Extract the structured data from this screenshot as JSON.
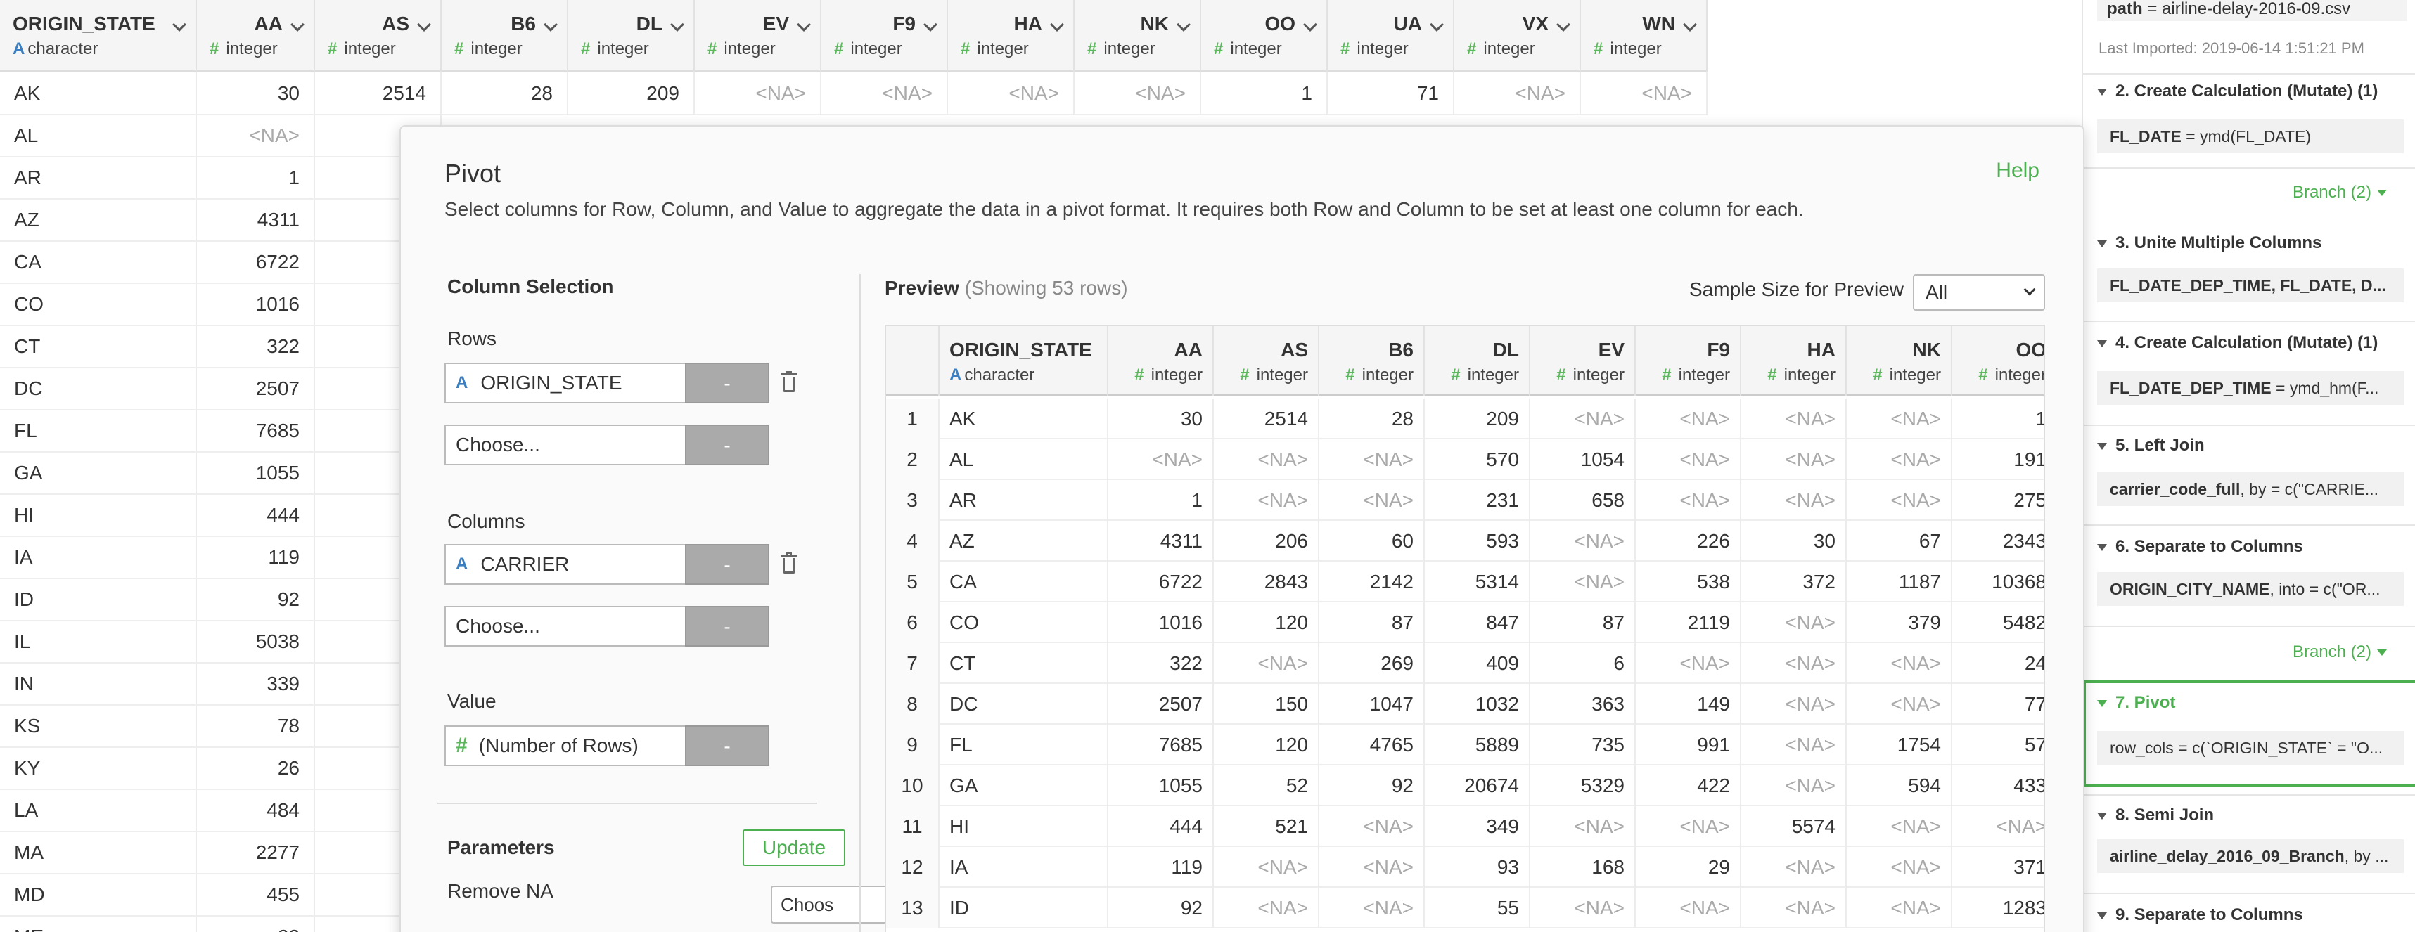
{
  "background_table": {
    "columns": [
      {
        "name": "ORIGIN_STATE",
        "type": "character",
        "icon": "a-char-icon"
      },
      {
        "name": "AA",
        "type": "integer",
        "icon": "hash-icon"
      },
      {
        "name": "AS",
        "type": "integer",
        "icon": "hash-icon"
      },
      {
        "name": "B6",
        "type": "integer",
        "icon": "hash-icon"
      },
      {
        "name": "DL",
        "type": "integer",
        "icon": "hash-icon"
      },
      {
        "name": "EV",
        "type": "integer",
        "icon": "hash-icon"
      },
      {
        "name": "F9",
        "type": "integer",
        "icon": "hash-icon"
      },
      {
        "name": "HA",
        "type": "integer",
        "icon": "hash-icon"
      },
      {
        "name": "NK",
        "type": "integer",
        "icon": "hash-icon"
      },
      {
        "name": "OO",
        "type": "integer",
        "icon": "hash-icon"
      },
      {
        "name": "UA",
        "type": "integer",
        "icon": "hash-icon"
      },
      {
        "name": "VX",
        "type": "integer",
        "icon": "hash-icon"
      },
      {
        "name": "WN",
        "type": "integer",
        "icon": "hash-icon"
      }
    ],
    "first_row": [
      "AK",
      "30",
      "2514",
      "28",
      "209",
      "<NA>",
      "<NA>",
      "<NA>",
      "<NA>",
      "1",
      "71",
      "<NA>",
      "<NA>"
    ],
    "rows": [
      [
        "AL",
        "<NA>",
        "<N"
      ],
      [
        "AR",
        "1",
        "<N"
      ],
      [
        "AZ",
        "4311",
        ""
      ],
      [
        "CA",
        "6722",
        "2"
      ],
      [
        "CO",
        "1016",
        ""
      ],
      [
        "CT",
        "322",
        "<N"
      ],
      [
        "DC",
        "2507",
        ""
      ],
      [
        "FL",
        "7685",
        ""
      ],
      [
        "GA",
        "1055",
        ""
      ],
      [
        "HI",
        "444",
        ""
      ],
      [
        "IA",
        "119",
        "<N"
      ],
      [
        "ID",
        "92",
        "<N"
      ],
      [
        "IL",
        "5038",
        ""
      ],
      [
        "IN",
        "339",
        "<N"
      ],
      [
        "KS",
        "78",
        "<N"
      ],
      [
        "KY",
        "26",
        "<N"
      ],
      [
        "LA",
        "484",
        ""
      ],
      [
        "MA",
        "2277",
        ""
      ],
      [
        "MD",
        "455",
        ""
      ],
      [
        "ME",
        "22",
        ""
      ]
    ]
  },
  "sidebar": {
    "path_label": "path",
    "path_value": " = airline-delay-2016-09.csv",
    "last_imported": "Last Imported: 2019-06-14 1:51:21 PM",
    "steps": [
      {
        "title": "2. Create Calculation (Mutate) (1)",
        "body_bold": "FL_DATE",
        "body_rest": " = ymd(FL_DATE)"
      },
      {
        "title": "3. Unite Multiple Columns",
        "body_bold": "FL_DATE_DEP_TIME, FL_DATE, D...",
        "body_rest": ""
      },
      {
        "title": "4. Create Calculation (Mutate) (1)",
        "body_bold": "FL_DATE_DEP_TIME",
        "body_rest": " = ymd_hm(F..."
      },
      {
        "title": "5. Left Join",
        "body_bold": "carrier_code_full",
        "body_rest": ", by = c(\"CARRIE..."
      },
      {
        "title": "6. Separate to Columns",
        "body_bold": "ORIGIN_CITY_NAME",
        "body_rest": ", into = c(\"OR..."
      },
      {
        "title": "7. Pivot",
        "body_bold": "",
        "body_rest": "row_cols = c(`ORIGIN_STATE` = \"O..."
      },
      {
        "title": "8. Semi Join",
        "body_bold": "airline_delay_2016_09_Branch",
        "body_rest": ", by ..."
      },
      {
        "title": "9. Separate to Columns",
        "body_bold": "",
        "body_rest": ""
      }
    ],
    "branch_label": "Branch (2)",
    "colors": {
      "accent": "#4caf50"
    }
  },
  "dialog": {
    "title": "Pivot",
    "help": "Help",
    "description": "Select columns for Row, Column, and Value to aggregate the data in a pivot format. It requires both Row and Column to be set at least one column for each.",
    "column_selection": "Column Selection",
    "rows_label": "Rows",
    "rows_value": "ORIGIN_STATE",
    "choose_placeholder": "Choose...",
    "columns_label": "Columns",
    "columns_value": "CARRIER",
    "value_label": "Value",
    "value_value": "(Number of Rows)",
    "minus": "-",
    "parameters": "Parameters",
    "update": "Update",
    "remove_na": "Remove NA",
    "remove_na_select": "Choos",
    "preview_label": "Preview",
    "preview_count": "(Showing 53 rows)",
    "sample_size_label": "Sample Size for Preview",
    "sample_size_value": "All"
  },
  "preview_table": {
    "columns": [
      {
        "name": "ORIGIN_STATE",
        "type": "character"
      },
      {
        "name": "AA",
        "type": "integer"
      },
      {
        "name": "AS",
        "type": "integer"
      },
      {
        "name": "B6",
        "type": "integer"
      },
      {
        "name": "DL",
        "type": "integer"
      },
      {
        "name": "EV",
        "type": "integer"
      },
      {
        "name": "F9",
        "type": "integer"
      },
      {
        "name": "HA",
        "type": "integer"
      },
      {
        "name": "NK",
        "type": "integer"
      },
      {
        "name": "OO",
        "type": "integer"
      }
    ],
    "rows": [
      [
        "1",
        "AK",
        "30",
        "2514",
        "28",
        "209",
        "<NA>",
        "<NA>",
        "<NA>",
        "<NA>",
        "1"
      ],
      [
        "2",
        "AL",
        "<NA>",
        "<NA>",
        "<NA>",
        "570",
        "1054",
        "<NA>",
        "<NA>",
        "<NA>",
        "191"
      ],
      [
        "3",
        "AR",
        "1",
        "<NA>",
        "<NA>",
        "231",
        "658",
        "<NA>",
        "<NA>",
        "<NA>",
        "275"
      ],
      [
        "4",
        "AZ",
        "4311",
        "206",
        "60",
        "593",
        "<NA>",
        "226",
        "30",
        "67",
        "2343"
      ],
      [
        "5",
        "CA",
        "6722",
        "2843",
        "2142",
        "5314",
        "<NA>",
        "538",
        "372",
        "1187",
        "10368"
      ],
      [
        "6",
        "CO",
        "1016",
        "120",
        "87",
        "847",
        "87",
        "2119",
        "<NA>",
        "379",
        "5482"
      ],
      [
        "7",
        "CT",
        "322",
        "<NA>",
        "269",
        "409",
        "6",
        "<NA>",
        "<NA>",
        "<NA>",
        "24"
      ],
      [
        "8",
        "DC",
        "2507",
        "150",
        "1047",
        "1032",
        "363",
        "149",
        "<NA>",
        "<NA>",
        "77"
      ],
      [
        "9",
        "FL",
        "7685",
        "120",
        "4765",
        "5889",
        "735",
        "991",
        "<NA>",
        "1754",
        "57"
      ],
      [
        "10",
        "GA",
        "1055",
        "52",
        "92",
        "20674",
        "5329",
        "422",
        "<NA>",
        "594",
        "433"
      ],
      [
        "11",
        "HI",
        "444",
        "521",
        "<NA>",
        "349",
        "<NA>",
        "<NA>",
        "5574",
        "<NA>",
        "<NA>"
      ],
      [
        "12",
        "IA",
        "119",
        "<NA>",
        "<NA>",
        "93",
        "168",
        "29",
        "<NA>",
        "<NA>",
        "371"
      ],
      [
        "13",
        "ID",
        "92",
        "<NA>",
        "<NA>",
        "55",
        "<NA>",
        "<NA>",
        "<NA>",
        "<NA>",
        "1283"
      ]
    ]
  }
}
